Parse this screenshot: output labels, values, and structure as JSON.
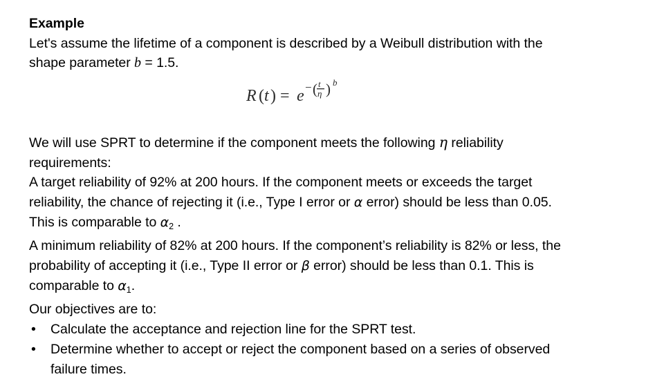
{
  "slide": {
    "background_color": "#ffffff",
    "text_color": "#000000",
    "heading": "Example",
    "intro": {
      "line1": "Let's assume the lifetime of a component is described by a Weibull distribution with the",
      "line2_prefix": "shape parameter ",
      "line2_var": "b",
      "line2_suffix": " = 1.5."
    },
    "formula": {
      "alt": "R(t) = e^{-(t/η)^b}",
      "lhs": "R(t)",
      "equals": "=",
      "base": "e",
      "exponent": "-(t/η)",
      "power": "b",
      "numerator": "t",
      "denominator": "η"
    },
    "body": {
      "line1_prefix": "We will use SPRT to determine if the component meets the following ",
      "line1_symbol": "η",
      "line1_suffix": "  reliability",
      "line2": "requirements:",
      "line3": "A target reliability of 92% at 200 hours. If the component meets or exceeds the target",
      "line4_prefix": "reliability, the chance of rejecting it (i.e., Type I error or ",
      "line4_symbol": "α",
      "line4_suffix": " error) should be less than 0.05.",
      "line5_prefix": "This is comparable to ",
      "line5_symbol": "α",
      "line5_subscript": "2",
      "line5_suffix": " .",
      "line6": "A minimum reliability of 82% at 200 hours. If the component’s reliability is 82% or less, the",
      "line7_prefix": "probability of accepting it (i.e., Type II error or ",
      "line7_symbol": "β",
      "line7_suffix": " error) should be less than 0.1. This is",
      "line8_prefix": "comparable to ",
      "line8_symbol": "α",
      "line8_subscript": "1",
      "line8_suffix": ".",
      "line9": "Our objectives are to:"
    },
    "bullets": {
      "marker": "•",
      "items": [
        {
          "text": "Calculate the acceptance and rejection line for the SPRT test."
        },
        {
          "text": "Determine whether to accept or reject the component based on a series of observed"
        },
        {
          "text": "failure times.",
          "continuation": true
        }
      ]
    }
  }
}
